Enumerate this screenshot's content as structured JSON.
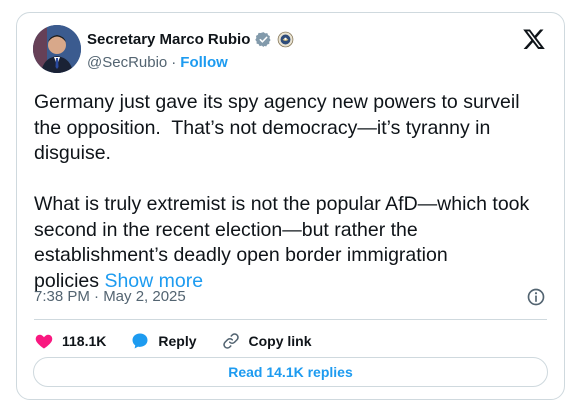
{
  "author": {
    "display_name": "Secretary Marco Rubio",
    "handle": "@SecRubio",
    "separator": "·",
    "follow_label": "Follow"
  },
  "tweet": {
    "text": "Germany just gave its spy agency new powers to surveil\nthe opposition.  That’s not democracy—it’s tyranny in\ndisguise.\n\nWhat is truly extremist is not the popular AfD—which took\nsecond in the recent election—but rather the\nestablishment’s deadly open border immigration\npolicies ",
    "show_more": "Show more",
    "timestamp": "7:38 PM · May 2, 2025"
  },
  "actions": {
    "likes": "118.1K",
    "reply_label": "Reply",
    "copy_link_label": "Copy link"
  },
  "footer": {
    "read_replies_label": "Read 14.1K replies"
  },
  "colors": {
    "accent": "#1d9bf0",
    "like": "#f91880",
    "muted": "#536471",
    "border": "#cfd9de"
  },
  "icons": [
    "verified-badge-icon",
    "seal-icon",
    "x-logo-icon",
    "info-icon",
    "heart-icon",
    "reply-bubble-icon",
    "link-icon"
  ]
}
